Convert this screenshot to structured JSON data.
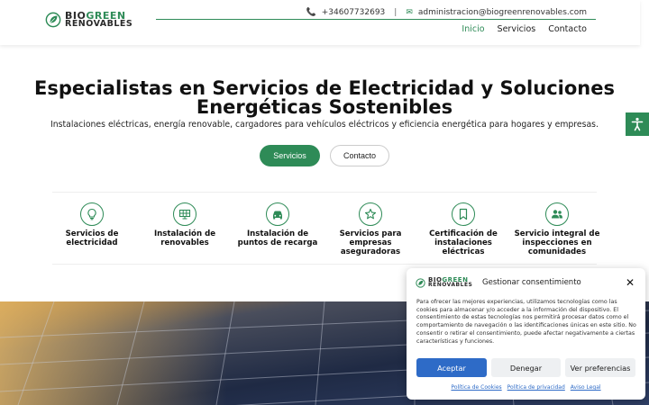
{
  "header": {
    "logo_top": "BIOGREEN",
    "logo_top_plain": "BIO",
    "logo_top_green": "GREEN",
    "logo_bottom": "RENOVABLES",
    "phone": "+34607732693",
    "separator": "|",
    "email": "administracion@biogreenrenovables.com",
    "nav": [
      {
        "label": "Inicio",
        "active": true
      },
      {
        "label": "Servicios",
        "active": false
      },
      {
        "label": "Contacto",
        "active": false
      }
    ]
  },
  "hero": {
    "title_line1": "Especialistas en Servicios de Electricidad y Soluciones",
    "title_line2": "Energéticas Sostenibles",
    "subtitle": "Instalaciones eléctricas, energía renovable, cargadores para vehículos eléctricos y eficiencia energética para hogares y empresas.",
    "primary_button": "Servicios",
    "secondary_button": "Contacto"
  },
  "services": [
    {
      "line1": "Servicios de",
      "line2": "electricidad",
      "line3": "",
      "icon": "lightbulb-icon"
    },
    {
      "line1": "Instalación de",
      "line2": "renovables",
      "line3": "",
      "icon": "solar-panel-icon"
    },
    {
      "line1": "Instalación de",
      "line2": "puntos de recarga",
      "line3": "",
      "icon": "car-icon"
    },
    {
      "line1": "Servicios para",
      "line2": "empresas",
      "line3": "aseguradoras",
      "icon": "star-icon"
    },
    {
      "line1": "Certificación de",
      "line2": "instalaciones",
      "line3": "eléctricas",
      "icon": "bookmark-icon"
    },
    {
      "line1": "Servicio integral de",
      "line2": "inspecciones en",
      "line3": "comunidades",
      "icon": "users-icon"
    }
  ],
  "cookie": {
    "title": "Gestionar consentimiento",
    "close": "✕",
    "text": "Para ofrecer las mejores experiencias, utilizamos tecnologías como las cookies para almacenar y/o acceder a la información del dispositivo. El consentimiento de estas tecnologías nos permitirá procesar datos como el comportamiento de navegación o las identificaciones únicas en este sitio. No consentir o retirar el consentimiento, puede afectar negativamente a ciertas características y funciones.",
    "accept": "Aceptar",
    "deny": "Denegar",
    "preferences": "Ver preferencias",
    "links": [
      "Política de Cookies",
      "Política de privacidad",
      "Aviso Legal"
    ]
  },
  "colors": {
    "brand_green": "#2e8b57",
    "cookie_blue": "#2e6bc7"
  }
}
